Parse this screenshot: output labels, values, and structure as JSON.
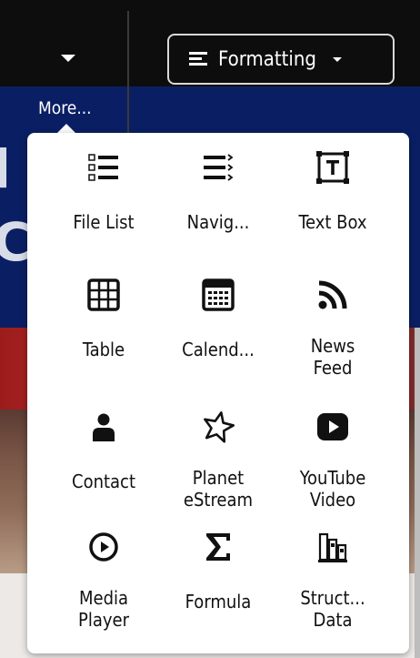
{
  "toolbar": {
    "more_label": "More...",
    "formatting_label": "Formatting"
  },
  "background": {
    "letters": [
      "l",
      "C"
    ]
  },
  "colors": {
    "toolbar_bg": "#0d0d0d",
    "banner_bg": "#0a1f63",
    "panel_bg": "#ffffff",
    "icon_color": "#111111"
  },
  "menu": {
    "items": [
      {
        "label": "File List",
        "icon": "file-list-icon"
      },
      {
        "label": "Navig...",
        "icon": "navigation-icon"
      },
      {
        "label": "Text Box",
        "icon": "text-box-icon"
      },
      {
        "label": "Table",
        "icon": "table-icon"
      },
      {
        "label": "Calend...",
        "icon": "calendar-icon"
      },
      {
        "label": "News\nFeed",
        "icon": "rss-feed-icon"
      },
      {
        "label": "Contact",
        "icon": "person-icon"
      },
      {
        "label": "Planet\neStream",
        "icon": "star-outline-icon"
      },
      {
        "label": "YouTube\nVideo",
        "icon": "youtube-play-icon"
      },
      {
        "label": "Media\nPlayer",
        "icon": "play-circle-icon"
      },
      {
        "label": "Formula",
        "icon": "sigma-icon"
      },
      {
        "label": "Struct...\nData",
        "icon": "structured-data-icon"
      }
    ]
  }
}
